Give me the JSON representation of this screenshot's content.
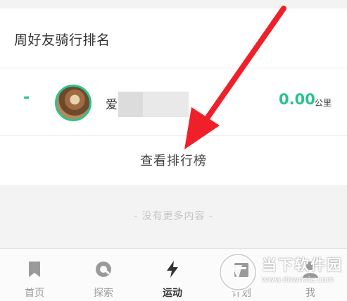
{
  "section": {
    "title": "周好友骑行排名"
  },
  "ranking": {
    "rank": "-",
    "name_visible": "爱",
    "distance": "0.00",
    "unit": "公里"
  },
  "view_rank_label": "查看排行榜",
  "empty_note": "- 没有更多内容 -",
  "tabs": [
    {
      "label": "首页",
      "icon": "bookmark-icon",
      "active": false
    },
    {
      "label": "探索",
      "icon": "compass-icon",
      "active": false
    },
    {
      "label": "运动",
      "icon": "lightning-icon",
      "active": true
    },
    {
      "label": "计划",
      "icon": "calendar-icon",
      "active": false
    },
    {
      "label": "我",
      "icon": "person-icon",
      "active": false
    }
  ],
  "watermark": {
    "name": "当下软件园",
    "url": "www.downxia.com"
  },
  "colors": {
    "accent": "#2cc28b",
    "arrow": "#f0202a",
    "text": "#333333",
    "muted": "#9a9a9a"
  }
}
